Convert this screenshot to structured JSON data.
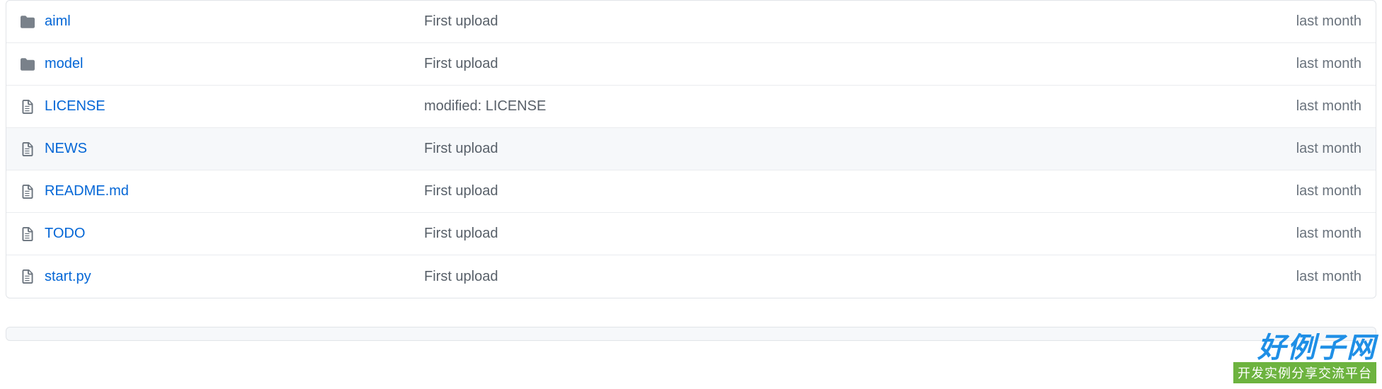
{
  "files": [
    {
      "type": "folder",
      "name": "aiml",
      "message": "First upload",
      "time": "last month"
    },
    {
      "type": "folder",
      "name": "model",
      "message": "First upload",
      "time": "last month"
    },
    {
      "type": "file",
      "name": "LICENSE",
      "message": "modified: LICENSE",
      "time": "last month"
    },
    {
      "type": "file",
      "name": "NEWS",
      "message": "First upload",
      "time": "last month",
      "hovered": true
    },
    {
      "type": "file",
      "name": "README.md",
      "message": "First upload",
      "time": "last month"
    },
    {
      "type": "file",
      "name": "TODO",
      "message": "First upload",
      "time": "last month"
    },
    {
      "type": "file",
      "name": "start.py",
      "message": "First upload",
      "time": "last month"
    }
  ],
  "watermark": {
    "title": "好例子网",
    "subtitle": "开发实例分享交流平台"
  }
}
